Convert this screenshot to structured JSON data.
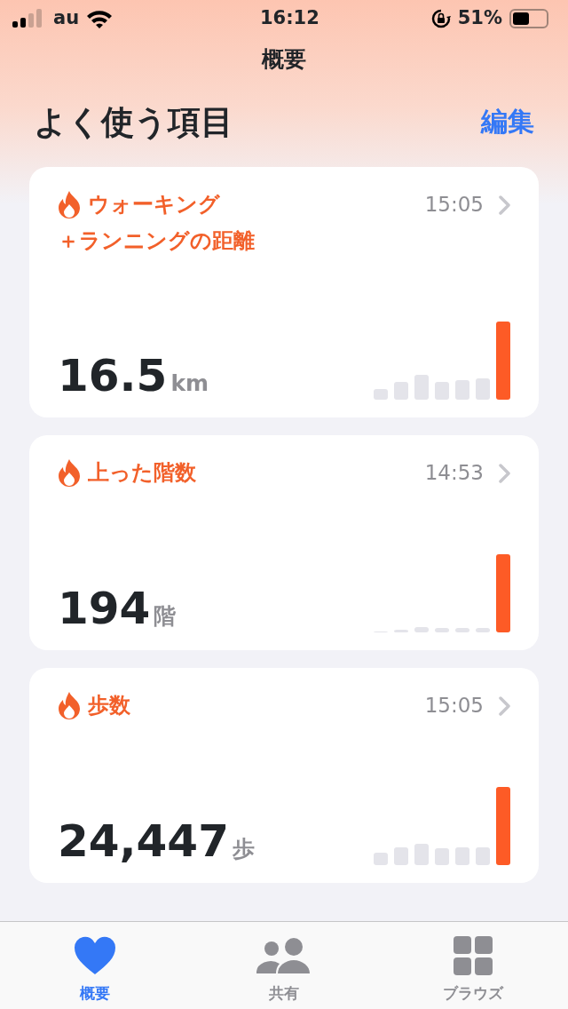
{
  "status_bar": {
    "carrier": "au",
    "time": "16:12",
    "battery": "51%"
  },
  "nav": {
    "title": "概要"
  },
  "section": {
    "title": "よく使う項目",
    "action": "編集"
  },
  "cards": [
    {
      "title_lines": [
        "ウォーキング",
        "＋ランニングの距離"
      ],
      "time": "15:05",
      "value": "16.5",
      "unit": "km"
    },
    {
      "title_lines": [
        "上った階数"
      ],
      "time": "14:53",
      "value": "194",
      "unit": "階"
    },
    {
      "title_lines": [
        "歩数"
      ],
      "time": "15:05",
      "value": "24,447",
      "unit": "歩"
    }
  ],
  "tabs": [
    {
      "label": "概要",
      "selected": true,
      "kind": "heart"
    },
    {
      "label": "共有",
      "selected": false,
      "kind": "people"
    },
    {
      "label": "ブラウズ",
      "selected": false,
      "kind": "grid"
    }
  ]
}
